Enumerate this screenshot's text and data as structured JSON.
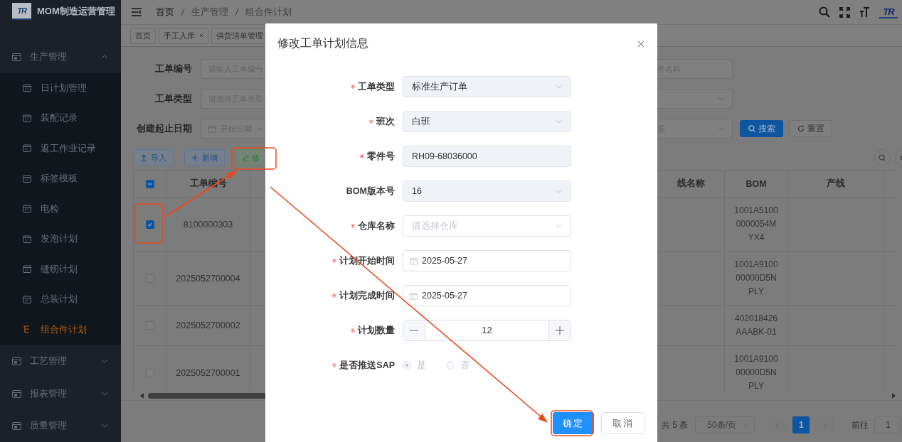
{
  "app": {
    "logo_text": "TR",
    "title": "MOM制造运营管理"
  },
  "sidebar": {
    "items": [
      {
        "label": "生产管理",
        "expanded": true,
        "children": [
          {
            "label": "日计划管理",
            "selected": false
          },
          {
            "label": "装配记录",
            "selected": false
          },
          {
            "label": "返工作业记录",
            "selected": false
          },
          {
            "label": "标签模板",
            "selected": false
          },
          {
            "label": "电检",
            "selected": false
          },
          {
            "label": "发泡计划",
            "selected": false
          },
          {
            "label": "缝纫计划",
            "selected": false
          },
          {
            "label": "总装计划",
            "selected": false
          },
          {
            "label": "组合件计划",
            "selected": true
          }
        ]
      },
      {
        "label": "工艺管理",
        "expanded": false
      },
      {
        "label": "报表管理",
        "expanded": false
      },
      {
        "label": "质量管理",
        "expanded": false
      }
    ]
  },
  "header": {
    "breadcrumb": [
      {
        "label": "首页",
        "link": true
      },
      {
        "label": "生产管理",
        "link": false
      },
      {
        "label": "组合件计划",
        "link": false
      }
    ],
    "logo_text": "TR"
  },
  "tags": [
    {
      "label": "首页",
      "closable": false
    },
    {
      "label": "手工入库",
      "closable": true
    },
    {
      "label": "供货清单管理",
      "closable": false
    }
  ],
  "filters": {
    "left": [
      {
        "label": "工单编号",
        "kind": "input",
        "placeholder": "请输入工单编号"
      },
      {
        "label": "工单类型",
        "kind": "select",
        "placeholder": "请选择工单类型"
      },
      {
        "label": "创建起止日期",
        "kind": "daterange",
        "placeholder": "开始日期",
        "separator": "-"
      }
    ],
    "right": [
      {
        "kind": "input",
        "placeholder": "件名称"
      },
      {
        "kind": "select"
      },
      {
        "kind": "select",
        "placeholder": "源"
      }
    ],
    "search_button": "搜索",
    "reset_button": "重置"
  },
  "toolbar": [
    {
      "label": "导入",
      "kind": "import"
    },
    {
      "label": "新增",
      "kind": "add"
    },
    {
      "label": "修",
      "kind": "edit"
    }
  ],
  "table": {
    "select_all_partial": true,
    "left_columns": [
      "工单编号"
    ],
    "right_columns": [
      "线名称",
      "BOM",
      "产线"
    ],
    "rows": [
      {
        "selected": true,
        "order_no": "8100000303",
        "bom": "1001A51000000054MYX4"
      },
      {
        "selected": false,
        "order_no": "2025052700004",
        "bom": "1001A910000000D5NPLY"
      },
      {
        "selected": false,
        "order_no": "2025052700002",
        "bom": "402018426AAABK-01"
      },
      {
        "selected": false,
        "order_no": "2025052700001",
        "bom": "1001A910000000D5NPLY"
      }
    ]
  },
  "pagination": {
    "total": "共 5 条",
    "page_size": "50条/页",
    "pages": [
      {
        "label": "1",
        "selected": true
      }
    ],
    "goto_label": "前往",
    "goto_value": "1"
  },
  "dialog": {
    "title": "修改工单计划信息",
    "fields": [
      {
        "label": "工单类型",
        "required": true,
        "kind": "select",
        "value": "标准生产订单",
        "disabled": true
      },
      {
        "label": "班次",
        "required": true,
        "kind": "select",
        "value": "白班",
        "disabled": true
      },
      {
        "label": "零件号",
        "required": true,
        "kind": "input",
        "value": "RH09-68036000",
        "disabled": true
      },
      {
        "label": "BOM版本号",
        "required": false,
        "kind": "select",
        "value": "16",
        "disabled": true
      },
      {
        "label": "仓库名称",
        "required": true,
        "kind": "select",
        "placeholder": "请选择仓库",
        "disabled": false
      },
      {
        "label": "计划开始时间",
        "required": true,
        "kind": "date",
        "value": "2025-05-27",
        "disabled": false
      },
      {
        "label": "计划完成时间",
        "required": true,
        "kind": "date",
        "value": "2025-05-27",
        "disabled": false
      },
      {
        "label": "计划数量",
        "required": true,
        "kind": "number",
        "value": "12",
        "disabled": false
      },
      {
        "label": "是否推送SAP",
        "required": true,
        "kind": "radio",
        "disabled": true,
        "options": [
          {
            "label": "是",
            "selected": true
          },
          {
            "label": "否",
            "selected": false
          }
        ]
      }
    ],
    "buttons": [
      {
        "label": "确定",
        "kind": "primary"
      },
      {
        "label": "取消",
        "kind": "default"
      }
    ]
  }
}
